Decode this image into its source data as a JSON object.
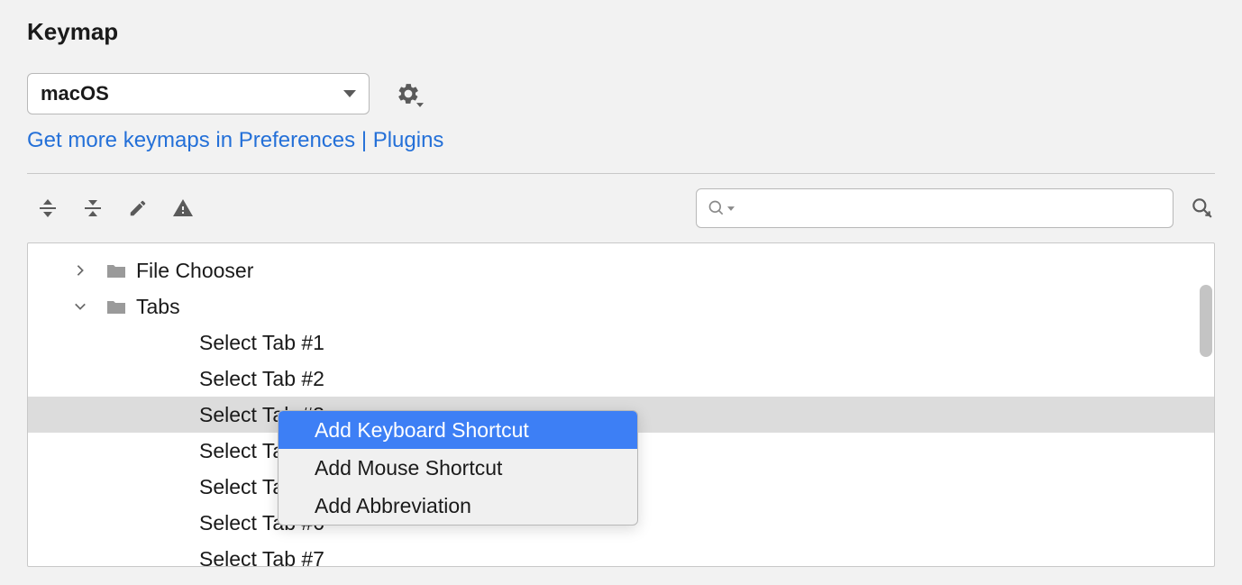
{
  "title": "Keymap",
  "dropdown": {
    "selected": "macOS"
  },
  "link": "Get more keymaps in Preferences | Plugins",
  "search": {
    "value": "",
    "placeholder": ""
  },
  "tree": {
    "items": [
      {
        "label": "File Chooser",
        "expanded": false,
        "hasChildren": true,
        "level": 1
      },
      {
        "label": "Tabs",
        "expanded": true,
        "hasChildren": true,
        "level": 1
      },
      {
        "label": "Select Tab #1",
        "level": 2
      },
      {
        "label": "Select Tab #2",
        "level": 2
      },
      {
        "label": "Select Tab #3",
        "level": 2,
        "selected": true
      },
      {
        "label": "Select Tab #4",
        "level": 2
      },
      {
        "label": "Select Tab #5",
        "level": 2
      },
      {
        "label": "Select Tab #6",
        "level": 2
      },
      {
        "label": "Select Tab #7",
        "level": 2
      }
    ]
  },
  "contextMenu": {
    "items": [
      {
        "label": "Add Keyboard Shortcut",
        "highlighted": true
      },
      {
        "label": "Add Mouse Shortcut",
        "highlighted": false
      },
      {
        "label": "Add Abbreviation",
        "highlighted": false
      }
    ]
  }
}
